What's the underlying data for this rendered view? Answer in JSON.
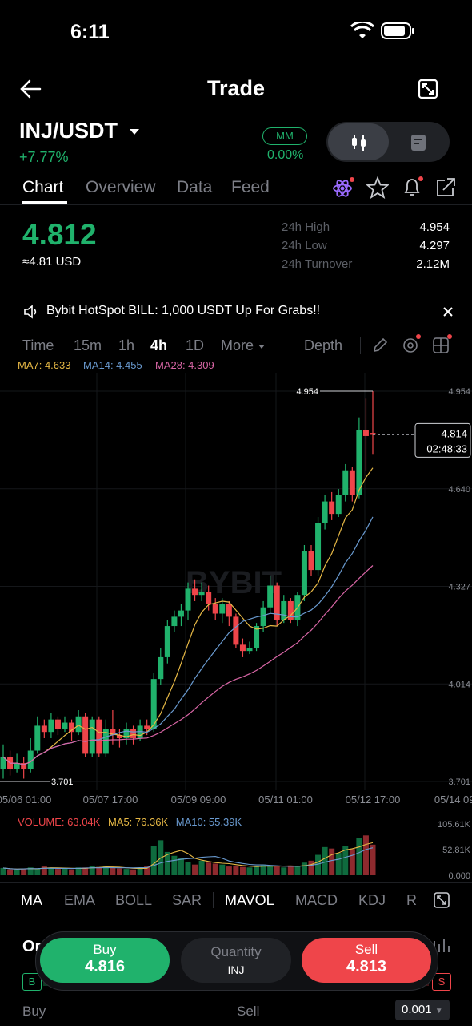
{
  "status": {
    "time": "6:11"
  },
  "header": {
    "title": "Trade"
  },
  "pair": {
    "name": "INJ/USDT",
    "change": "+7.77%",
    "mm_label": "MM",
    "mm_value": "0.00%"
  },
  "tabs": [
    "Chart",
    "Overview",
    "Data",
    "Feed"
  ],
  "ticker": {
    "price": "4.812",
    "usd": "≈4.81 USD",
    "stats": [
      {
        "label": "24h High",
        "value": "4.954"
      },
      {
        "label": "24h Low",
        "value": "4.297"
      },
      {
        "label": "24h Turnover",
        "value": "2.12M"
      }
    ]
  },
  "banner": {
    "text": "Bybit HotSpot BILL: 1,000 USDT Up For Grabs!!"
  },
  "timeframes": {
    "items": [
      "Time",
      "15m",
      "1h",
      "4h",
      "1D"
    ],
    "more": "More",
    "depth": "Depth"
  },
  "ma_legend": {
    "ma7": "MA7: 4.633",
    "ma14": "MA14: 4.455",
    "ma28": "MA28: 4.309"
  },
  "colors": {
    "up": "#20b26c",
    "down": "#ef454a",
    "ma7": "#e6b845",
    "ma14": "#6a9bd1",
    "ma28": "#d966a6"
  },
  "watermark": "BYBIT",
  "chart_data": {
    "type": "candlestick",
    "y_ticks": [
      "4.954",
      "4.640",
      "4.327",
      "4.014",
      "3.701"
    ],
    "x_ticks": [
      "05/06 01:00",
      "05/07 17:00",
      "05/09 09:00",
      "05/11 01:00",
      "05/12 17:00",
      "05/14 09:"
    ],
    "high_marker": "4.954",
    "low_marker": "3.701",
    "last_price": "4.814",
    "countdown": "02:48:33",
    "ylim": [
      3.701,
      4.954
    ],
    "candles": [
      [
        3.74,
        3.78,
        3.82,
        3.71
      ],
      [
        3.78,
        3.74,
        3.8,
        3.72
      ],
      [
        3.74,
        3.76,
        3.79,
        3.73
      ],
      [
        3.76,
        3.74,
        3.78,
        3.71
      ],
      [
        3.74,
        3.8,
        3.84,
        3.73
      ],
      [
        3.8,
        3.88,
        3.91,
        3.79
      ],
      [
        3.88,
        3.86,
        3.9,
        3.84
      ],
      [
        3.86,
        3.9,
        3.92,
        3.84
      ],
      [
        3.9,
        3.87,
        3.91,
        3.85
      ],
      [
        3.87,
        3.89,
        3.91,
        3.86
      ],
      [
        3.89,
        3.86,
        3.9,
        3.83
      ],
      [
        3.86,
        3.91,
        3.93,
        3.85
      ],
      [
        3.91,
        3.79,
        3.92,
        3.78
      ],
      [
        3.79,
        3.9,
        3.91,
        3.78
      ],
      [
        3.9,
        3.79,
        3.91,
        3.78
      ],
      [
        3.79,
        3.87,
        3.9,
        3.78
      ],
      [
        3.87,
        3.85,
        3.93,
        3.82
      ],
      [
        3.85,
        3.84,
        3.87,
        3.81
      ],
      [
        3.84,
        3.87,
        3.89,
        3.82
      ],
      [
        3.87,
        3.84,
        3.88,
        3.82
      ],
      [
        3.84,
        3.88,
        3.9,
        3.83
      ],
      [
        3.88,
        3.87,
        3.9,
        3.85
      ],
      [
        3.87,
        4.03,
        4.05,
        3.86
      ],
      [
        4.03,
        4.1,
        4.13,
        4.01
      ],
      [
        4.1,
        4.2,
        4.22,
        4.08
      ],
      [
        4.2,
        4.23,
        4.25,
        4.18
      ],
      [
        4.23,
        4.25,
        4.27,
        4.2
      ],
      [
        4.25,
        4.32,
        4.34,
        4.22
      ],
      [
        4.32,
        4.3,
        4.35,
        4.28
      ],
      [
        4.3,
        4.31,
        4.34,
        4.28
      ],
      [
        4.31,
        4.27,
        4.33,
        4.25
      ],
      [
        4.27,
        4.24,
        4.29,
        4.22
      ],
      [
        4.24,
        4.27,
        4.29,
        4.21
      ],
      [
        4.27,
        4.23,
        4.28,
        4.2
      ],
      [
        4.23,
        4.14,
        4.24,
        4.13
      ],
      [
        4.14,
        4.12,
        4.16,
        4.1
      ],
      [
        4.12,
        4.13,
        4.15,
        4.11
      ],
      [
        4.13,
        4.2,
        4.21,
        4.12
      ],
      [
        4.2,
        4.26,
        4.28,
        4.18
      ],
      [
        4.26,
        4.33,
        4.36,
        4.24
      ],
      [
        4.33,
        4.22,
        4.34,
        4.2
      ],
      [
        4.22,
        4.28,
        4.3,
        4.21
      ],
      [
        4.28,
        4.22,
        4.29,
        4.21
      ],
      [
        4.22,
        4.3,
        4.31,
        4.2
      ],
      [
        4.3,
        4.44,
        4.46,
        4.28
      ],
      [
        4.44,
        4.38,
        4.46,
        4.36
      ],
      [
        4.38,
        4.53,
        4.55,
        4.36
      ],
      [
        4.53,
        4.6,
        4.62,
        4.51
      ],
      [
        4.6,
        4.56,
        4.63,
        4.54
      ],
      [
        4.56,
        4.62,
        4.64,
        4.55
      ],
      [
        4.62,
        4.7,
        4.72,
        4.6
      ],
      [
        4.7,
        4.62,
        4.71,
        4.6
      ],
      [
        4.62,
        4.83,
        4.87,
        4.61
      ],
      [
        4.83,
        4.81,
        4.93,
        4.7
      ],
      [
        4.82,
        4.814,
        4.954,
        4.75
      ]
    ],
    "volume": {
      "legend": {
        "vol": "VOLUME: 63.04K",
        "ma5": "MA5: 76.36K",
        "ma10": "MA10: 55.39K"
      },
      "y_ticks": [
        "105.61K",
        "52.81K",
        "0.000"
      ],
      "ylim": [
        0,
        105.61
      ],
      "values": [
        15,
        12,
        11,
        14,
        16,
        14,
        18,
        15,
        13,
        14,
        12,
        16,
        16,
        19,
        17,
        18,
        15,
        14,
        13,
        12,
        15,
        18,
        60,
        72,
        48,
        40,
        36,
        28,
        22,
        30,
        26,
        24,
        22,
        18,
        20,
        17,
        16,
        18,
        22,
        20,
        18,
        16,
        20,
        18,
        26,
        30,
        42,
        58,
        55,
        46,
        60,
        54,
        76,
        82,
        63
      ]
    }
  },
  "indicator_tabs": {
    "items": [
      "MA",
      "EMA",
      "BOLL",
      "SAR"
    ],
    "items2": [
      "MAVOL",
      "MACD",
      "KDJ",
      "R"
    ]
  },
  "bottom": {
    "buy_label": "Buy",
    "buy_price": "4.816",
    "qty_label": "Quantity",
    "qty_unit": "INJ",
    "sell_label": "Sell",
    "sell_price": "4.813",
    "order_tab": "Or",
    "b_badge": "B",
    "s_badge": "S",
    "row_buy": "Buy",
    "row_sell": "Sell",
    "precision": "0.001"
  }
}
